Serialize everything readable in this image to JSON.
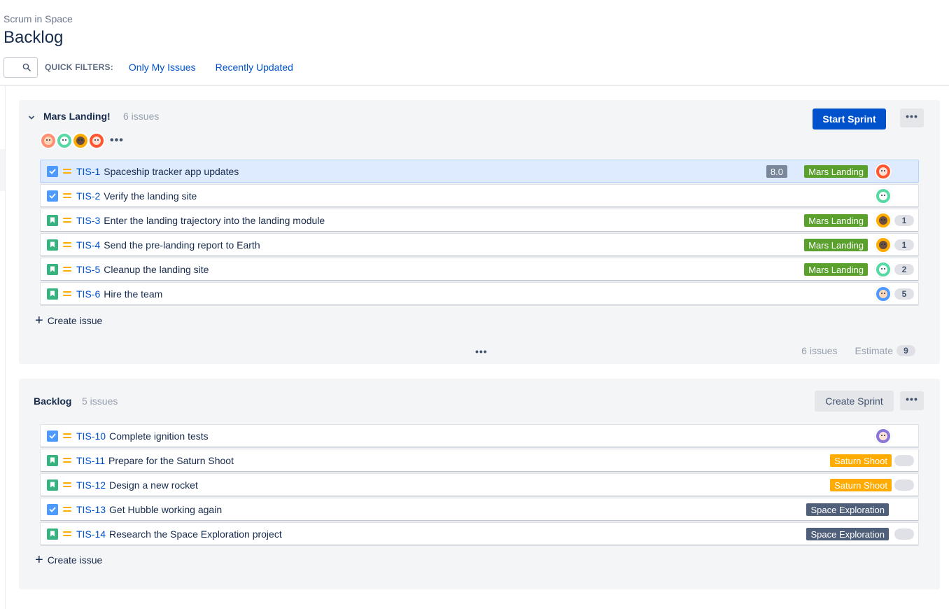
{
  "breadcrumb": "Scrum in Space",
  "page_title": "Backlog",
  "toolbar": {
    "quick_filters_label": "QUICK FILTERS:",
    "filters": [
      "Only My Issues",
      "Recently Updated"
    ]
  },
  "colors": {
    "primary": "#0052cc",
    "mars_landing": "#5aa02c",
    "saturn_shoot": "#ffab00",
    "space_exploration": "#505f79"
  },
  "sprint": {
    "name": "Mars Landing!",
    "count_label": "6 issues",
    "start_button": "Start Sprint",
    "more_label": "•••",
    "create_issue": "Create issue",
    "footer_count": "6 issues",
    "footer_estimate_label": "Estimate",
    "footer_estimate_value": "9",
    "center_dots": "•••",
    "issues": [
      {
        "type": "task",
        "key": "TIS-1",
        "summary": "Spaceship tracker app updates",
        "estimate": "8.0",
        "epic": "Mars Landing",
        "points": ""
      },
      {
        "type": "task",
        "key": "TIS-2",
        "summary": "Verify the landing site",
        "estimate": "",
        "epic": "",
        "points": ""
      },
      {
        "type": "story",
        "key": "TIS-3",
        "summary": "Enter the landing trajectory into the landing module",
        "estimate": "",
        "epic": "Mars Landing",
        "points": "1"
      },
      {
        "type": "story",
        "key": "TIS-4",
        "summary": "Send the pre-landing report to Earth",
        "estimate": "",
        "epic": "Mars Landing",
        "points": "1"
      },
      {
        "type": "story",
        "key": "TIS-5",
        "summary": "Cleanup the landing site",
        "estimate": "",
        "epic": "Mars Landing",
        "points": "2"
      },
      {
        "type": "story",
        "key": "TIS-6",
        "summary": "Hire the team",
        "estimate": "",
        "epic": "",
        "points": "5"
      }
    ]
  },
  "backlog": {
    "name": "Backlog",
    "count_label": "5 issues",
    "create_sprint_button": "Create Sprint",
    "more_label": "•••",
    "create_issue": "Create issue",
    "issues": [
      {
        "type": "task",
        "key": "TIS-10",
        "summary": "Complete ignition tests",
        "epic": "",
        "points": ""
      },
      {
        "type": "story",
        "key": "TIS-11",
        "summary": "Prepare for the Saturn Shoot",
        "epic": "Saturn Shoot",
        "points": ""
      },
      {
        "type": "story",
        "key": "TIS-12",
        "summary": "Design a new rocket",
        "epic": "Saturn Shoot",
        "points": ""
      },
      {
        "type": "task",
        "key": "TIS-13",
        "summary": "Get Hubble working again",
        "epic": "Space Exploration",
        "points": ""
      },
      {
        "type": "story",
        "key": "TIS-14",
        "summary": "Research the Space Exploration project",
        "epic": "Space Exploration",
        "points": ""
      }
    ]
  }
}
